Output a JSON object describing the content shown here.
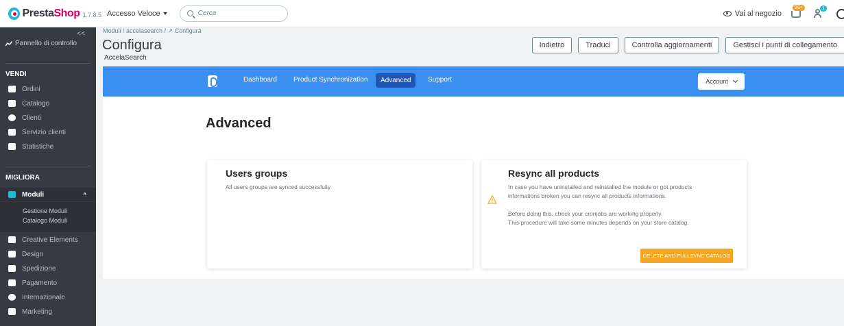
{
  "topbar": {
    "logo_prefix": "Presta",
    "logo_suffix": "Shop",
    "version": "1.7.8.5",
    "quick_access": "Accesso Veloce",
    "search_placeholder": "Cerca",
    "view_store": "Vai al negozio",
    "orders_badge": "99+",
    "customers_badge": "1"
  },
  "sidebar": {
    "collapse": "<<",
    "dashboard": "Pannello di controllo",
    "sections": [
      "VENDI",
      "MIGLIORA"
    ],
    "sell_items": [
      "Ordini",
      "Catalogo",
      "Clienti",
      "Servizio clienti",
      "Statistiche"
    ],
    "improve_active": "Moduli",
    "module_subitems": [
      "Gestione Moduli",
      "Catalogo Moduli"
    ],
    "improve_items": [
      "Creative Elements",
      "Design",
      "Spedizione",
      "Pagamento",
      "Internazionale",
      "Marketing"
    ]
  },
  "header": {
    "breadcrumb": "Moduli / accelasearch / ↗ Configura",
    "title": "Configura",
    "subtitle": "AccelaSearch",
    "buttons": [
      "Indietro",
      "Traduci",
      "Controlla aggiornamenti",
      "Gestisci i punti di collegamento"
    ]
  },
  "module_nav": {
    "tabs": [
      "Dashboard",
      "Product Synchronization",
      "Advanced",
      "Support"
    ],
    "active": "Advanced",
    "account": "Account"
  },
  "page": {
    "title": "Advanced",
    "users_groups": {
      "title": "Users groups",
      "text": "All users groups are synced successfully"
    },
    "resync": {
      "title": "Resync all products",
      "lines": [
        "In case you have uninstalled and reinstalled the module or got products",
        "informations broken you can resync all products informations.",
        "Before doing this, check your cronjobs are working properly.",
        "This procedure will take some minutes depends on your store catalog."
      ],
      "button": "DELETE AND FULLSYNC CATALOG"
    }
  },
  "colors": {
    "brand": "#df0067",
    "accent": "#25b9d7",
    "module_bar": "#3b8ff0",
    "sync_button": "#f5a623"
  }
}
